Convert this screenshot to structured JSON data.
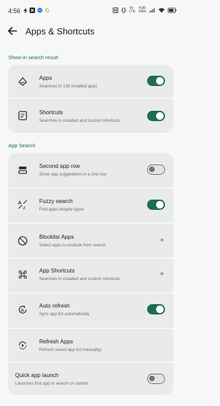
{
  "status_bar": {
    "time": "4:56",
    "left_icons": [
      "lightning-icon",
      "x-app-icon",
      "messenger-icon",
      "google-icon"
    ],
    "network_text": [
      "Vo",
      "LTE",
      "4.90",
      "KB/s"
    ],
    "battery": "battery-icon"
  },
  "app_bar": {
    "back_icon": "arrow-left-icon",
    "title": "Apps & Shortcuts"
  },
  "sections": {
    "search_result": {
      "header": "Show in search result",
      "rows": [
        {
          "title": "Apps",
          "subtitle": "Searches in 138 installed apps",
          "icon": "apps-icon",
          "control": "toggle",
          "on": true
        },
        {
          "title": "Shortcuts",
          "subtitle": "Searches in installed and custom shortcuts",
          "icon": "shortcuts-icon",
          "control": "toggle",
          "on": true
        }
      ]
    },
    "app_search": {
      "header": "App Search",
      "rows": [
        {
          "title": "Second app row",
          "subtitle": "Show app suggestions in a 2nd row",
          "icon": "two-rows-icon",
          "control": "toggle",
          "on": false
        },
        {
          "title": "Fuzzy search",
          "subtitle": "Find apps despite typos",
          "icon": "fuzzy-search-icon",
          "control": "toggle",
          "on": true
        },
        {
          "title": "Blocklist Apps",
          "subtitle": "Select apps to exclude from search",
          "icon": "block-icon",
          "control": "chevron",
          "chevron": "»"
        },
        {
          "title": "App Shortcuts",
          "subtitle": "Searches in installed and custom shortcuts",
          "icon": "command-icon",
          "control": "chevron",
          "chevron": "»"
        },
        {
          "title": "Auto refresh",
          "subtitle": "Sync app list automatically",
          "icon": "auto-refresh-icon",
          "control": "toggle",
          "on": true
        },
        {
          "title": "Refresh Apps",
          "subtitle": "Refresh saved app list manuallyy",
          "icon": "refresh-icon",
          "control": "none"
        },
        {
          "title": "Quick app launch",
          "subtitle": "Launches first app in search on submit",
          "icon": "",
          "control": "toggle",
          "on": false
        }
      ]
    }
  },
  "colors": {
    "accent": "#1f6b55",
    "card": "#e8ebe9",
    "background": "#f6f7f6"
  }
}
